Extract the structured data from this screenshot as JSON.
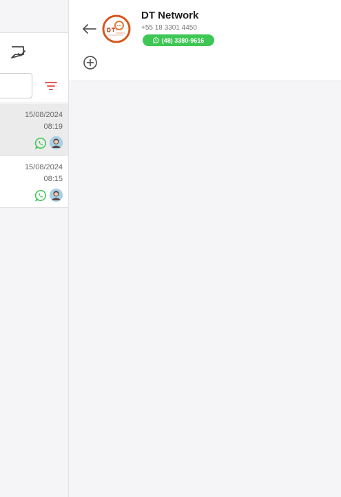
{
  "contact": {
    "name": "DT Network",
    "phone": "+55 18 3301 4450",
    "whatsapp_number": "(48) 3380-9616"
  },
  "conversations": [
    {
      "date": "15/08/2024",
      "time": "08:19",
      "selected": true
    },
    {
      "date": "15/08/2024",
      "time": "08:15",
      "selected": false
    }
  ],
  "colors": {
    "whatsapp_green": "#3ec755",
    "filter_red": "#e0433f",
    "logo_orange": "#d7561c"
  },
  "icons": {
    "back": "arrow-left-icon",
    "add": "plus-circle-icon",
    "chat_check": "chat-check-icon",
    "filter": "filter-icon",
    "whatsapp": "whatsapp-icon"
  }
}
